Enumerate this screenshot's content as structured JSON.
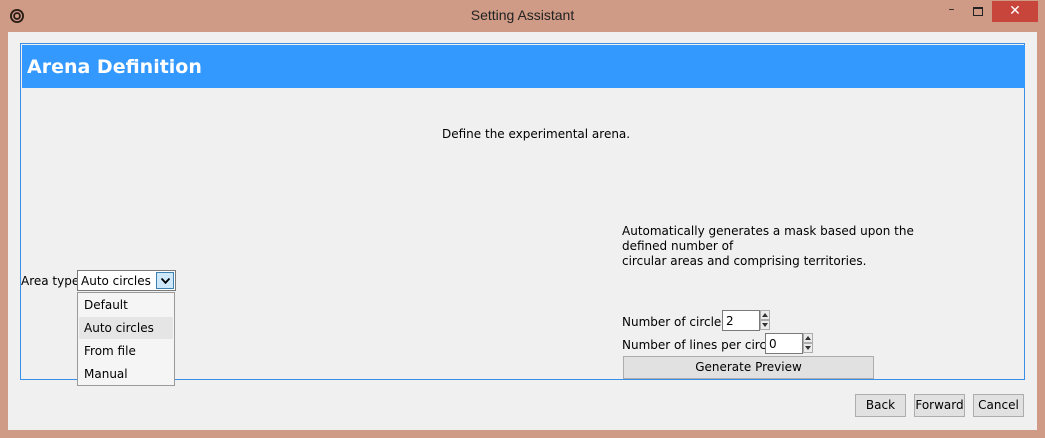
{
  "window": {
    "title": "Setting Assistant",
    "minimize_glyph": "–",
    "close_glyph": "✕"
  },
  "banner": {
    "title": "Arena Definition"
  },
  "main": {
    "instruction": "Define the experimental arena."
  },
  "area_type": {
    "label": "Area type:",
    "selected": "Auto circles",
    "options": [
      "Default",
      "Auto circles",
      "From file",
      "Manual"
    ]
  },
  "description": {
    "lines": [
      "Automatically generates a mask based upon the",
      "defined number of",
      "circular areas and comprising territories."
    ]
  },
  "circles": {
    "label": "Number of circles:",
    "value": "2"
  },
  "lines_per_circle": {
    "label": "Number of lines per circle:",
    "value": "0"
  },
  "generate_button": "Generate Preview",
  "footer": {
    "back": "Back",
    "forward": "Forward",
    "cancel": "Cancel"
  },
  "colors": {
    "banner": "#3399ff",
    "frame": "#cf9b86",
    "close": "#c7453a",
    "panel_border": "#3b8ee6"
  },
  "icons": [
    "app-icon",
    "minimize-icon",
    "maximize-icon",
    "close-icon",
    "chevron-down-icon",
    "spin-up-icon",
    "spin-down-icon"
  ]
}
